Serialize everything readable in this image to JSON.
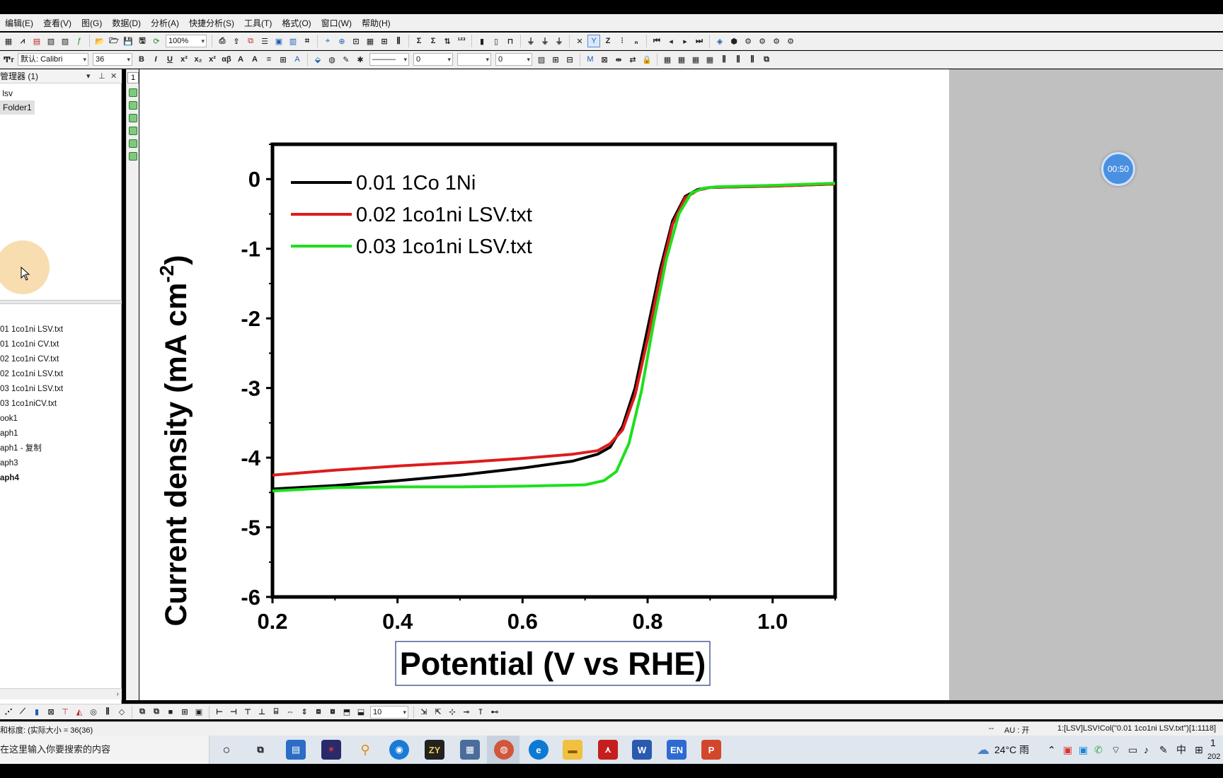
{
  "menu": [
    "编辑(E)",
    "查看(V)",
    "图(G)",
    "数据(D)",
    "分析(A)",
    "快捷分析(S)",
    "工具(T)",
    "格式(O)",
    "窗口(W)",
    "帮助(H)"
  ],
  "toolbar": {
    "zoom": "100%",
    "font_label": "默认: Calibri",
    "font_size": "36",
    "line_width": "0",
    "fill_width": "0",
    "step_value": "10"
  },
  "left_panel": {
    "title": "管理器 (1)",
    "tree": [
      "lsv",
      "Folder1"
    ],
    "items": [
      "01 1co1ni  LSV.txt",
      "01 1co1ni CV.txt",
      "02 1co1ni CV.txt",
      "02 1co1ni LSV.txt",
      "03 1co1ni LSV.txt",
      "03 1co1niCV.txt",
      "ook1",
      "aph1",
      "aph1 - 复制",
      "aph3",
      "aph4"
    ],
    "bold_item": "aph4"
  },
  "strip": {
    "tab": "1"
  },
  "timer": "00:50",
  "status": {
    "left": "和标度: (实际大小 = 36(36)",
    "dashes": "--",
    "au": "AU : 开",
    "cell": "1:[LSV]LSV!Col(\"0.01 1co1ni  LSV.txt\")[1:1118]"
  },
  "taskbar": {
    "search": "在这里输入你要搜索的内容",
    "weather": "24°C 雨",
    "ime": "中",
    "time": "1",
    "date": "202",
    "apps": [
      "ZY",
      "EN"
    ]
  },
  "colors": {
    "black_series": "#000000",
    "red_series": "#dd1c1c",
    "green_series": "#1de01d",
    "timer": "#4a90e2"
  },
  "chart_data": {
    "type": "line",
    "xlabel": "Potential (V vs RHE)",
    "ylabel": "Current density (mA cm",
    "ylabel_sup": "-2",
    "ylabel_close": ")",
    "xlim": [
      0.2,
      1.1
    ],
    "ylim": [
      -6,
      0.5
    ],
    "xticks": [
      "0.2",
      "0.4",
      "0.6",
      "0.8",
      "1.0"
    ],
    "xtick_values": [
      0.2,
      0.4,
      0.6,
      0.8,
      1.0
    ],
    "yticks": [
      "0",
      "-1",
      "-2",
      "-3",
      "-4",
      "-5",
      "-6"
    ],
    "ytick_values": [
      0,
      -1,
      -2,
      -3,
      -4,
      -5,
      -6
    ],
    "legend_position": "top-left",
    "series": [
      {
        "name": "0.01 1Co 1Ni",
        "color": "#000000",
        "x": [
          0.2,
          0.3,
          0.4,
          0.5,
          0.6,
          0.68,
          0.72,
          0.74,
          0.76,
          0.78,
          0.8,
          0.82,
          0.84,
          0.86,
          0.88,
          0.9,
          1.0,
          1.1
        ],
        "y": [
          -4.45,
          -4.4,
          -4.33,
          -4.25,
          -4.15,
          -4.05,
          -3.95,
          -3.85,
          -3.55,
          -3.0,
          -2.15,
          -1.3,
          -0.6,
          -0.25,
          -0.15,
          -0.12,
          -0.1,
          -0.07
        ]
      },
      {
        "name": "0.02 1co1ni LSV.txt",
        "color": "#dd1c1c",
        "x": [
          0.2,
          0.3,
          0.4,
          0.5,
          0.6,
          0.68,
          0.72,
          0.74,
          0.76,
          0.78,
          0.8,
          0.82,
          0.84,
          0.86,
          0.88,
          0.9,
          1.0,
          1.1
        ],
        "y": [
          -4.25,
          -4.18,
          -4.12,
          -4.07,
          -4.01,
          -3.95,
          -3.9,
          -3.8,
          -3.6,
          -3.1,
          -2.3,
          -1.4,
          -0.65,
          -0.27,
          -0.16,
          -0.12,
          -0.1,
          -0.07
        ]
      },
      {
        "name": "0.03 1co1ni LSV.txt",
        "color": "#1de01d",
        "x": [
          0.2,
          0.3,
          0.4,
          0.5,
          0.6,
          0.7,
          0.73,
          0.75,
          0.77,
          0.79,
          0.81,
          0.83,
          0.85,
          0.87,
          0.89,
          0.91,
          1.0,
          1.1
        ],
        "y": [
          -4.48,
          -4.43,
          -4.42,
          -4.42,
          -4.41,
          -4.39,
          -4.33,
          -4.2,
          -3.8,
          -3.05,
          -2.05,
          -1.15,
          -0.5,
          -0.2,
          -0.13,
          -0.11,
          -0.09,
          -0.06
        ]
      }
    ]
  }
}
